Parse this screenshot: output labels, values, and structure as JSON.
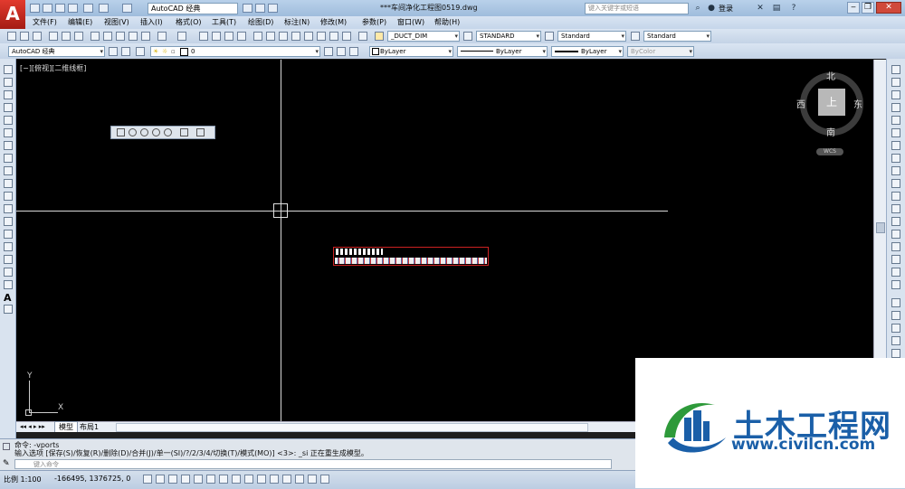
{
  "app": {
    "logo_letter": "A",
    "window_title": "***车间净化工程图0519.dwg"
  },
  "quick_access": {
    "workspace": "AutoCAD 经典"
  },
  "search": {
    "placeholder": "键入关键字或短语"
  },
  "account": {
    "login": "登录"
  },
  "menu": [
    "文件(F)",
    "编辑(E)",
    "视图(V)",
    "插入(I)",
    "格式(O)",
    "工具(T)",
    "绘图(D)",
    "标注(N)",
    "修改(M)",
    "参数(P)",
    "窗口(W)",
    "帮助(H)"
  ],
  "toolbar1": {
    "dim_style": "_DUCT_DIM",
    "text_style": "STANDARD",
    "table_style": "Standard",
    "mleader_style": "Standard"
  },
  "toolbar2": {
    "workspace": "AutoCAD 经典",
    "layer": "0",
    "color": "ByLayer",
    "linetype": "ByLayer",
    "lineweight": "ByLayer",
    "plotstyle": "ByColor"
  },
  "viewport": {
    "label": "[−][俯视][二维线框]"
  },
  "viewcube": {
    "north": "北",
    "south": "南",
    "east": "东",
    "west": "西",
    "top": "上",
    "wcs": "WCS"
  },
  "ucs": {
    "x": "X",
    "y": "Y"
  },
  "layout_tabs": [
    "模型",
    "布局1"
  ],
  "command": {
    "line1": "命令: -vports",
    "line2": "输入选项 [保存(S)/恢复(R)/删除(D)/合并(J)/单一(SI)/?/2/3/4/切换(T)/模式(MO)] <3>: _si 正在重生成模型。",
    "placeholder": "键入命令"
  },
  "status": {
    "scale": "比例 1:100",
    "coords": "-166495, 1376725, 0"
  },
  "watermark": {
    "brand": "土木工程网",
    "url": "www.civilcn.com"
  },
  "colors": {
    "canvas": "#000000",
    "accent_red": "#cc2222",
    "brand_blue": "#1a5fa8",
    "brand_green": "#2e9a3a"
  }
}
